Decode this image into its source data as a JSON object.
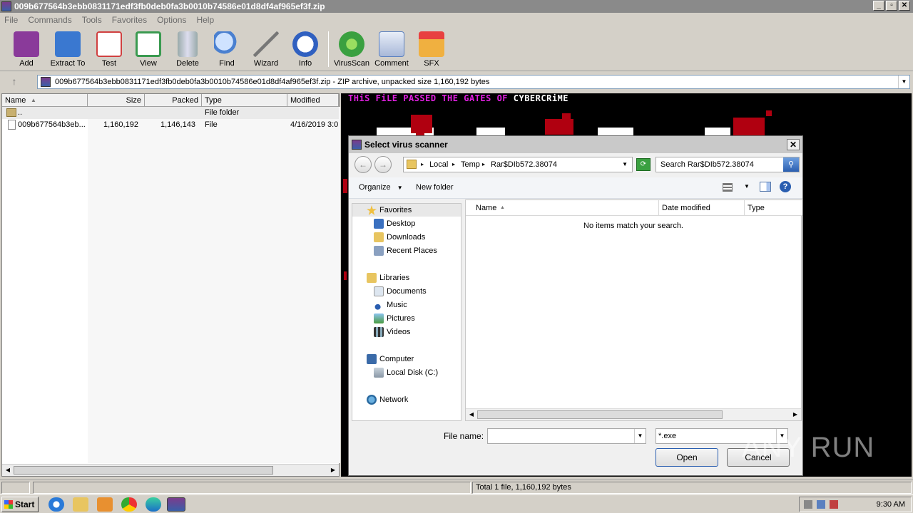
{
  "window": {
    "title": "009b677564b3ebb0831171edf3fb0deb0fa3b0010b74586e01d8df4af965ef3f.zip",
    "controls": [
      "_",
      "▫",
      "✕"
    ]
  },
  "menu": [
    "File",
    "Commands",
    "Tools",
    "Favorites",
    "Options",
    "Help"
  ],
  "toolbar": [
    {
      "label": "Add",
      "icon": "add-archive-icon",
      "color": "#8a3a9a"
    },
    {
      "label": "Extract To",
      "icon": "extract-folder-icon",
      "color": "#3a78d0"
    },
    {
      "label": "Test",
      "icon": "test-checklist-icon",
      "color": "#d04040"
    },
    {
      "label": "View",
      "icon": "view-book-icon",
      "color": "#3a9a50"
    },
    {
      "label": "Delete",
      "icon": "trash-icon",
      "color": "#7a8aa0"
    },
    {
      "label": "Find",
      "icon": "magnifier-icon",
      "color": "#4a80d0"
    },
    {
      "label": "Wizard",
      "icon": "wand-icon",
      "color": "#a0a0a0"
    },
    {
      "label": "Info",
      "icon": "info-icon",
      "color": "#3060c0"
    },
    {
      "label": "VirusScan",
      "icon": "virus-scan-icon",
      "color": "#3aa040"
    },
    {
      "label": "Comment",
      "icon": "comment-icon",
      "color": "#5a80c0"
    },
    {
      "label": "SFX",
      "icon": "sfx-box-icon",
      "color": "#e08030"
    }
  ],
  "address": {
    "path": "009b677564b3ebb0831171edf3fb0deb0fa3b0010b74586e01d8df4af965ef3f.zip - ZIP archive, unpacked size 1,160,192 bytes"
  },
  "filelist": {
    "columns": [
      "Name",
      "Size",
      "Packed",
      "Type",
      "Modified"
    ],
    "rows": [
      {
        "name": "..",
        "size": "",
        "packed": "",
        "type": "File folder",
        "modified": ""
      },
      {
        "name": "009b677564b3eb...",
        "size": "1,160,192",
        "packed": "1,146,143",
        "type": "File",
        "modified": "4/16/2019 3:0"
      }
    ]
  },
  "background_banner": {
    "prefix": "THiS FiLE PASSED THE GATES OF",
    "suffix": "CYBERCRiME",
    "prefix_color": "#e020e0",
    "suffix_color": "#ffffff"
  },
  "dialog": {
    "title": "Select virus scanner",
    "breadcrumb": [
      "Local",
      "Temp",
      "Rar$DIb572.38074"
    ],
    "search_placeholder": "Search Rar$DIb572.38074",
    "organize": "Organize",
    "new_folder": "New folder",
    "nav": {
      "favorites": "Favorites",
      "favorites_items": [
        "Desktop",
        "Downloads",
        "Recent Places"
      ],
      "libraries": "Libraries",
      "libraries_items": [
        "Documents",
        "Music",
        "Pictures",
        "Videos"
      ],
      "computer": "Computer",
      "computer_items": [
        "Local Disk (C:)"
      ],
      "network": "Network"
    },
    "columns": [
      "Name",
      "Date modified",
      "Type"
    ],
    "empty_message": "No items match your search.",
    "file_name_label": "File name:",
    "file_name_value": "",
    "filter": "*.exe",
    "open": "Open",
    "cancel": "Cancel"
  },
  "status": {
    "text": "Total 1 file, 1,160,192 bytes"
  },
  "taskbar": {
    "start": "Start",
    "clock": "9:30 AM"
  },
  "watermark": "ANY RUN"
}
